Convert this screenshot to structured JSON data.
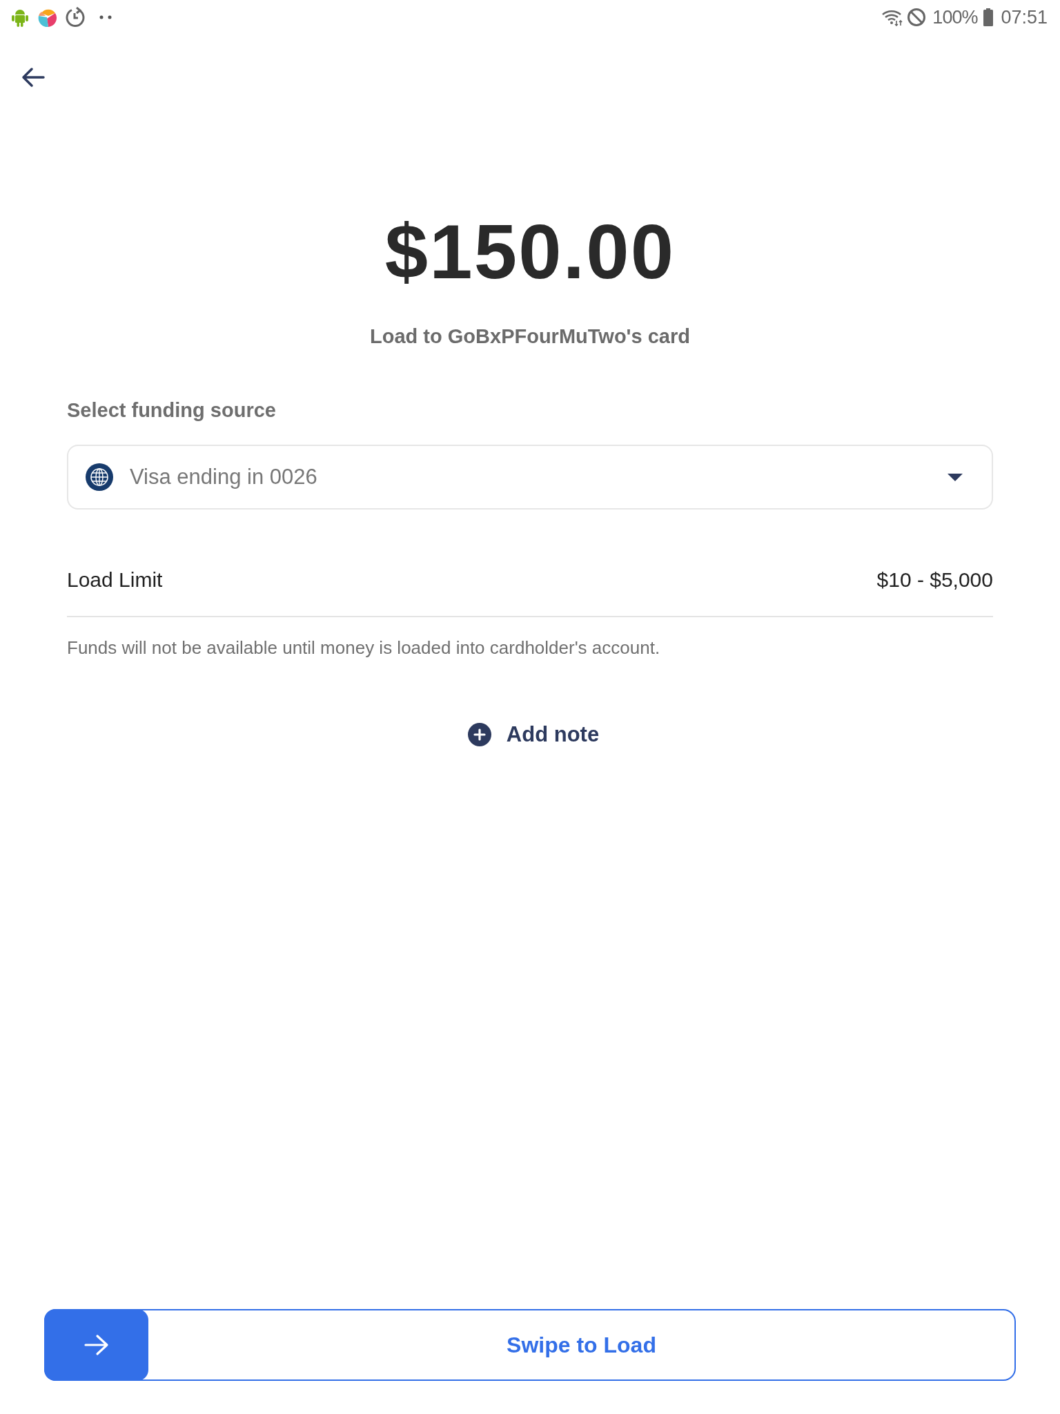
{
  "status_bar": {
    "battery": "100%",
    "time": "07:51"
  },
  "amount": "$150.00",
  "subtitle": "Load to GoBxPFourMuTwo's card",
  "funding_source": {
    "label": "Select funding source",
    "value": "Visa ending in 0026"
  },
  "load_limit": {
    "label": "Load Limit",
    "value": "$10 - $5,000"
  },
  "notice": "Funds will not be available until money is loaded into cardholder's account.",
  "add_note": {
    "label": "Add note"
  },
  "swipe": {
    "label": "Swipe to Load"
  }
}
